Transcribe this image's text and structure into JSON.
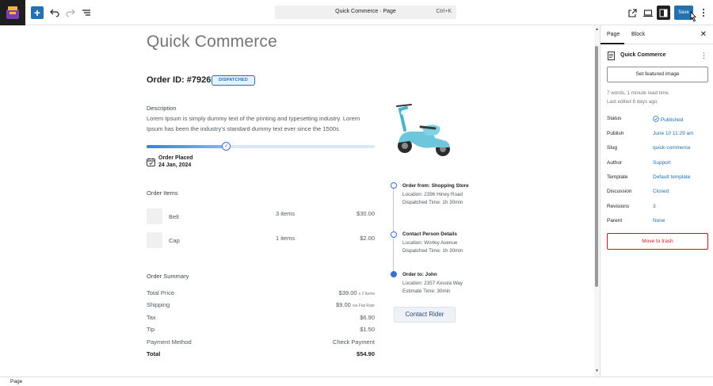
{
  "toolbar": {
    "command_title": "Quick Commerce · Page",
    "command_shortcut": "Ctrl+K",
    "save_label": "Save"
  },
  "page": {
    "title": "Quick Commerce",
    "order_id": "Order ID: #7926",
    "status_badge": "DISPATCHED",
    "description_label": "Description",
    "description_text": "Lorem Ipsum is simply dummy text of the printing and typesetting industry. Lorem Ipsum has been the industry's standard dummy text ever since the 1500s",
    "progress_fraction": 0.35,
    "order_placed_label": "Order Placed",
    "order_placed_date": "24 Jan, 2024",
    "order_items_label": "Order Items",
    "items": [
      {
        "name": "Belt",
        "qty": "3 items",
        "price": "$30.00"
      },
      {
        "name": "Cap",
        "qty": "1 items",
        "price": "$2.00"
      }
    ],
    "summary_label": "Order Summary",
    "summary": [
      {
        "label": "Total Price",
        "value": "$39.00",
        "note": "x 2 Items"
      },
      {
        "label": "Shipping",
        "value": "$9.00",
        "note": "via Flat Rate"
      },
      {
        "label": "Tax",
        "value": "$6.90",
        "note": ""
      },
      {
        "label": "Tip",
        "value": "$1.50",
        "note": ""
      },
      {
        "label": "Payment Method",
        "value": "Check Payment",
        "note": ""
      },
      {
        "label": "Total",
        "value": "$54.90",
        "note": ""
      }
    ],
    "timeline": [
      {
        "title": "Order from: Shopping Store",
        "lines": [
          "Location: 2396 Hiney Road",
          "Dispatched Time: 1h 30min"
        ]
      },
      {
        "title": "Contact Person Details",
        "lines": [
          "Location: Worley Avenue",
          "Dispatched Time: 1h 30min"
        ]
      },
      {
        "title": "Order to: John",
        "lines": [
          "Location: 2357 Kessla Way",
          "Estimate Time: 30min"
        ]
      }
    ],
    "contact_rider_label": "Contact Rider"
  },
  "sidebar": {
    "tab_page": "Page",
    "tab_block": "Block",
    "doc_name": "Quick Commerce",
    "featured_image_label": "Set featured image",
    "read_time": "7 words, 1 minute read time.",
    "last_edited": "Last edited 6 days ago.",
    "props": [
      {
        "key": "Status",
        "value": "Published"
      },
      {
        "key": "Publish",
        "value": "June 10 11:29 am"
      },
      {
        "key": "Slug",
        "value": "quick-commerce"
      },
      {
        "key": "Author",
        "value": "Support"
      },
      {
        "key": "Template",
        "value": "Default template"
      },
      {
        "key": "Discussion",
        "value": "Closed"
      },
      {
        "key": "Revisions",
        "value": "3"
      },
      {
        "key": "Parent",
        "value": "None"
      }
    ],
    "trash_label": "Move to trash"
  },
  "statusbar": {
    "label": "Page"
  },
  "colors": {
    "accent": "#2271b1",
    "danger": "#cc1818",
    "progress": "#3a7fdc"
  }
}
